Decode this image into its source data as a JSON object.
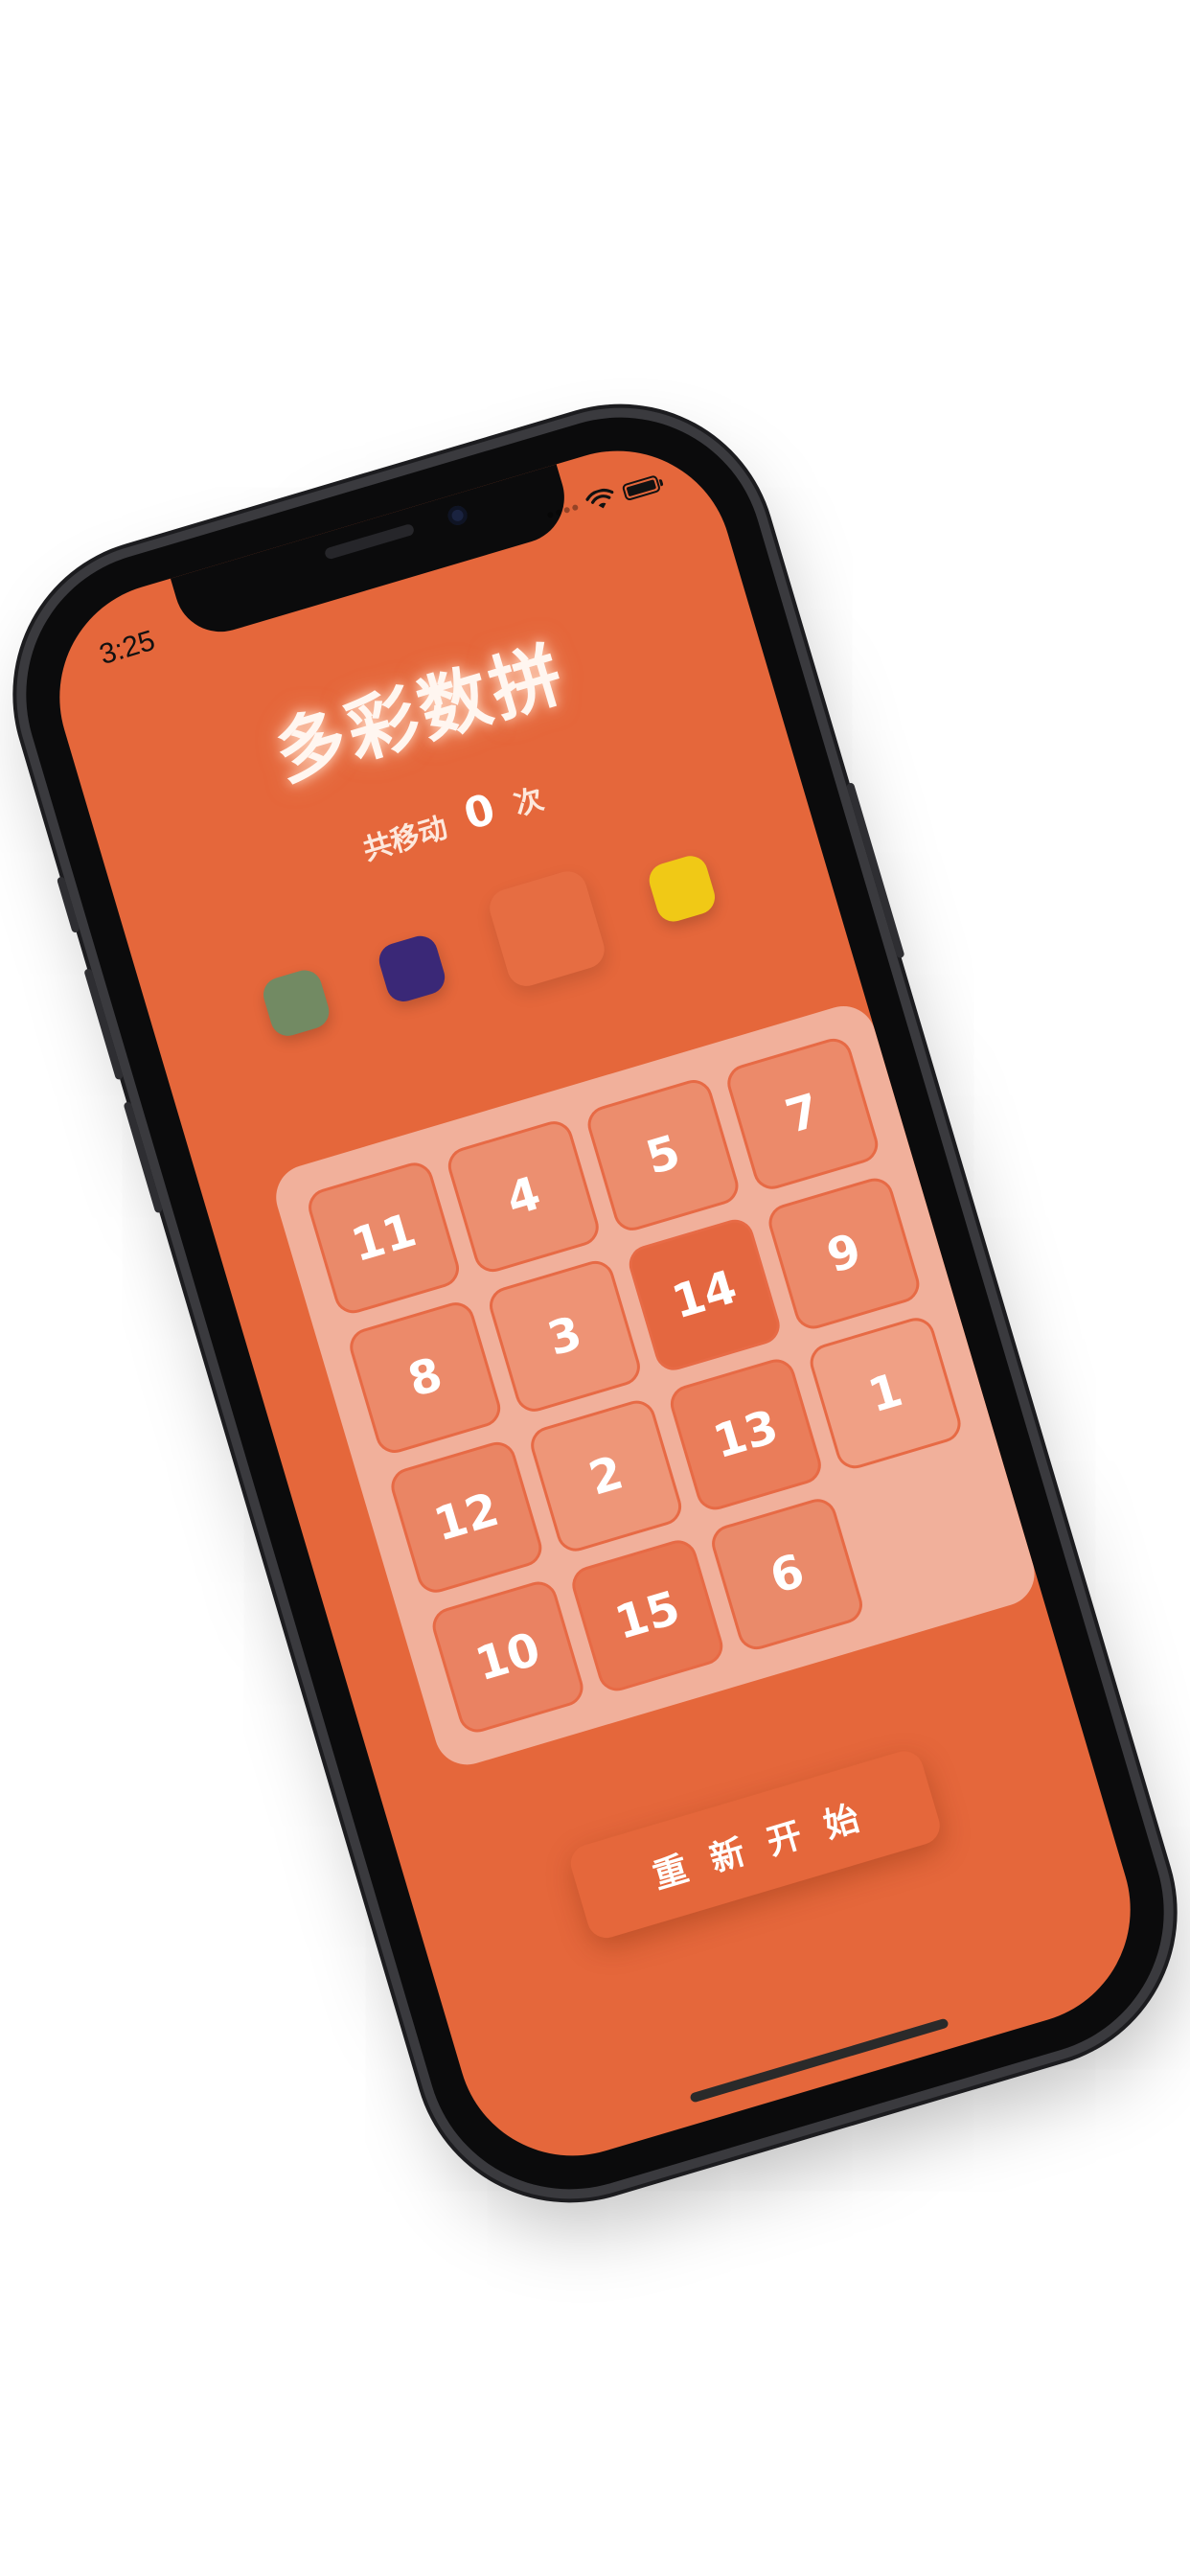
{
  "status_bar": {
    "time": "3:25"
  },
  "app": {
    "title": "多彩数拼",
    "moves_prefix": "共移动",
    "moves_count": "0",
    "moves_suffix": "次",
    "restart_label": "重新开始"
  },
  "swatches": [
    {
      "name": "green",
      "color": "#728a63"
    },
    {
      "name": "indigo",
      "color": "#3a2877"
    },
    {
      "name": "orange",
      "color": "#e66d42"
    },
    {
      "name": "yellow",
      "color": "#f0c916"
    }
  ],
  "board": {
    "tiles": [
      {
        "label": "11",
        "color": "#ea8a6a"
      },
      {
        "label": "4",
        "color": "#ec8f70"
      },
      {
        "label": "5",
        "color": "#ec8d6d"
      },
      {
        "label": "7",
        "color": "#ec8a6a"
      },
      {
        "label": "8",
        "color": "#ec8a6a"
      },
      {
        "label": "3",
        "color": "#ee9375"
      },
      {
        "label": "14",
        "color": "#e46740"
      },
      {
        "label": "9",
        "color": "#ec8a6a"
      },
      {
        "label": "12",
        "color": "#ea8564"
      },
      {
        "label": "2",
        "color": "#ee9678"
      },
      {
        "label": "13",
        "color": "#ea7d5a"
      },
      {
        "label": "1",
        "color": "#f0a085"
      },
      {
        "label": "10",
        "color": "#ea8262"
      },
      {
        "label": "15",
        "color": "#e87550"
      },
      {
        "label": "6",
        "color": "#ea8a6a"
      },
      {
        "label": "",
        "color": ""
      }
    ]
  },
  "colors": {
    "screen_bg": "#e5673b",
    "board_bg": "#f1b09b",
    "tile_border": "#e76a45"
  },
  "icons": [
    "wifi-icon",
    "battery-icon",
    "signal-icon"
  ]
}
